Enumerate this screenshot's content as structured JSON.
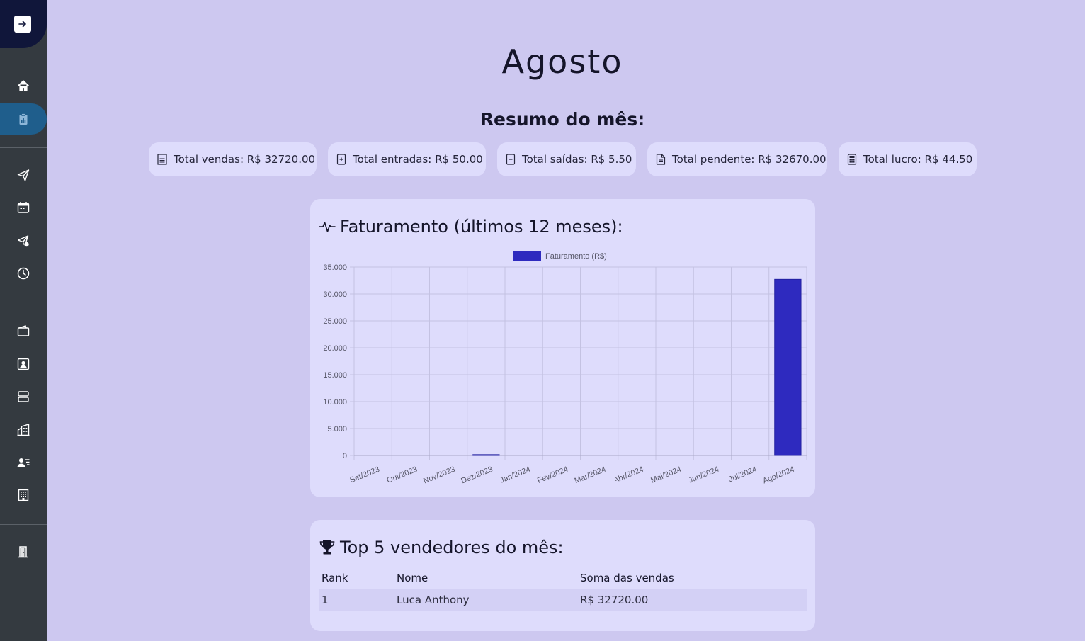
{
  "page": {
    "month_title": "Agosto",
    "summary_title": "Resumo do mês:"
  },
  "sidebar": {
    "items": [
      {
        "name": "home",
        "icon": "home-icon"
      },
      {
        "name": "report",
        "icon": "clipboard-icon",
        "active": true
      },
      {
        "name": "send",
        "icon": "send-icon"
      },
      {
        "name": "calendar",
        "icon": "calendar-icon"
      },
      {
        "name": "send-check",
        "icon": "send-check-icon"
      },
      {
        "name": "history",
        "icon": "clock-icon"
      },
      {
        "name": "wallet",
        "icon": "wallet-icon"
      },
      {
        "name": "contacts",
        "icon": "person-badge-icon"
      },
      {
        "name": "storage",
        "icon": "hdd-stack-icon"
      },
      {
        "name": "buildings",
        "icon": "buildings-icon"
      },
      {
        "name": "people-list",
        "icon": "person-lines-icon"
      },
      {
        "name": "building",
        "icon": "building-icon"
      },
      {
        "name": "logout",
        "icon": "door-icon"
      }
    ]
  },
  "summary": {
    "cards": [
      {
        "label": "Total vendas: R$ 32720.00",
        "icon": "receipt-icon"
      },
      {
        "label": "Total entradas: R$ 50.00",
        "icon": "file-plus-icon"
      },
      {
        "label": "Total saídas: R$ 5.50",
        "icon": "file-minus-icon"
      },
      {
        "label": "Total pendente: R$ 32670.00",
        "icon": "file-text-icon"
      },
      {
        "label": "Total lucro: R$ 44.50",
        "icon": "calculator-icon"
      }
    ]
  },
  "chart_panel": {
    "title": "Faturamento (últimos 12 meses):",
    "icon": "activity-icon"
  },
  "chart_data": {
    "type": "bar",
    "categories": [
      "Set/2023",
      "Out/2023",
      "Nov/2023",
      "Dez/2023",
      "Jan/2024",
      "Fev/2024",
      "Mar/2024",
      "Abr/2024",
      "Mai/2024",
      "Jun/2024",
      "Jul/2024",
      "Ago/2024"
    ],
    "series": [
      {
        "name": "Faturamento (R$)",
        "values": [
          0,
          0,
          0,
          150,
          0,
          0,
          0,
          0,
          0,
          0,
          0,
          32720
        ],
        "color": "#2e2abf"
      }
    ],
    "yticks": [
      "0",
      "5.000",
      "10.000",
      "15.000",
      "20.000",
      "25.000",
      "30.000",
      "35.000"
    ],
    "ylim": [
      0,
      35000
    ],
    "grid": true,
    "legend": "top"
  },
  "ranking_panel": {
    "title": "Top 5 vendedores do mês:",
    "icon": "trophy-icon",
    "headers": {
      "rank": "Rank",
      "name": "Nome",
      "sum": "Soma das vendas"
    },
    "rows": [
      {
        "rank": "1",
        "name": "Luca Anthony",
        "sum": "R$ 32720.00"
      }
    ]
  },
  "colors": {
    "background": "#cdc8f0",
    "panel": "#dedcfc",
    "sidebar": "#343a40",
    "sidebar_active": "#1f5e8c",
    "bar": "#2e2abf"
  }
}
